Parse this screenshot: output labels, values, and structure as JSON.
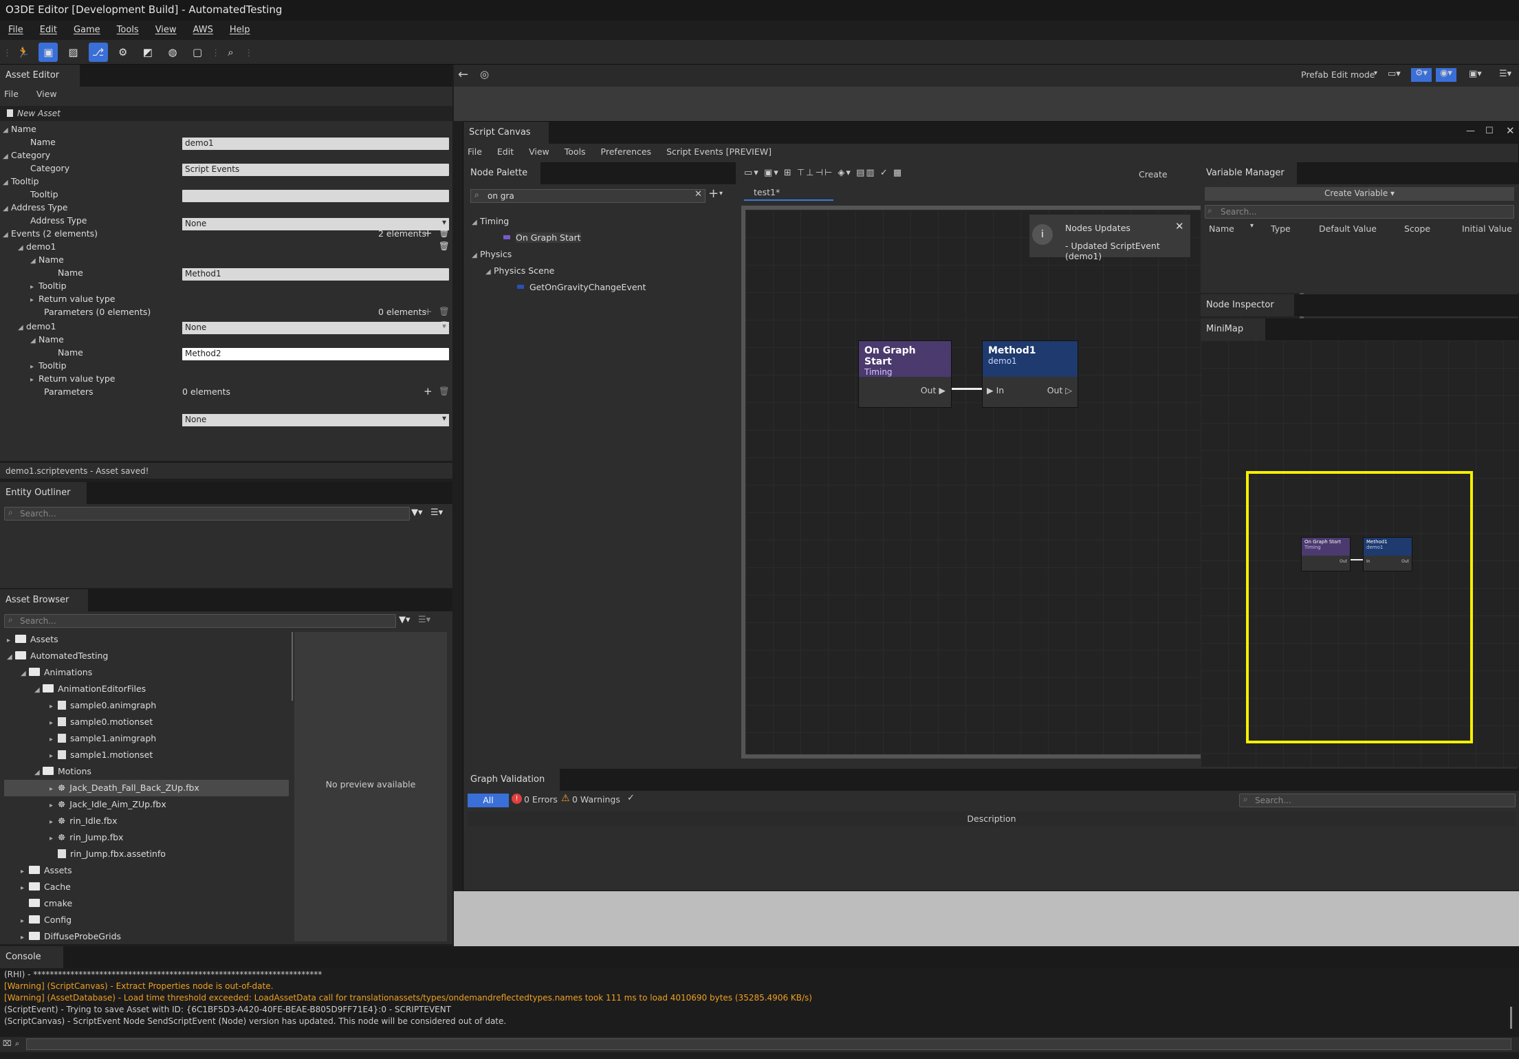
{
  "window": {
    "title": "O3DE Editor [Development Build] - AutomatedTesting"
  },
  "menu": [
    "File",
    "Edit",
    "Game",
    "Tools",
    "View",
    "AWS",
    "Help"
  ],
  "toolbar": {
    "icons": [
      "run-icon",
      "blueprint-icon",
      "image-icon",
      "script-icon",
      "gear-path-icon",
      "landscape-icon",
      "globe-icon",
      "screen-icon",
      "search-icon"
    ]
  },
  "asset_editor": {
    "tab": "Asset Editor",
    "menu": [
      "File",
      "View"
    ],
    "new_asset": "New Asset",
    "rows": {
      "name_group": "Name",
      "name_label": "Name",
      "name_value": "demo1",
      "category_group": "Category",
      "category_label": "Category",
      "category_value": "Script Events",
      "tooltip_group": "Tooltip",
      "tooltip_label": "Tooltip",
      "tooltip_value": "",
      "address_type_label": "Address Type",
      "address_type_value": "None",
      "address_type_sub": "Address Type",
      "events_label": "Events (2 elements)",
      "events_count": "2 elements",
      "ev1": "demo1",
      "ev1_name_group": "Name",
      "ev1_name_label": "Name",
      "ev1_name_value": "Method1",
      "ev1_tooltip": "Tooltip",
      "ev1_return_label": "Return value type",
      "ev1_return_value": "None",
      "ev1_params": "Parameters (0 elements)",
      "ev1_params_count": "0 elements",
      "ev2": "demo1",
      "ev2_name_group": "Name",
      "ev2_name_label": "Name",
      "ev2_name_value": "Method2",
      "ev2_tooltip": "Tooltip",
      "ev2_return_label": "Return value type",
      "ev2_return_value": "None",
      "ev2_params": "Parameters",
      "ev2_params_count": "0 elements"
    },
    "status": "demo1.scriptevents - Asset saved!"
  },
  "entity_outliner": {
    "tab": "Entity Outliner",
    "search_placeholder": "Search..."
  },
  "asset_browser": {
    "tab": "Asset Browser",
    "search_placeholder": "Search...",
    "preview": "No preview available",
    "tree": [
      {
        "label": "Assets",
        "type": "folder"
      },
      {
        "label": "AutomatedTesting",
        "type": "folder"
      },
      {
        "label": "Animations",
        "type": "folder"
      },
      {
        "label": "AnimationEditorFiles",
        "type": "folder"
      },
      {
        "label": "sample0.animgraph",
        "type": "file"
      },
      {
        "label": "sample0.motionset",
        "type": "file"
      },
      {
        "label": "sample1.animgraph",
        "type": "file"
      },
      {
        "label": "sample1.motionset",
        "type": "file"
      },
      {
        "label": "Motions",
        "type": "folder"
      },
      {
        "label": "Jack_Death_Fall_Back_ZUp.fbx",
        "type": "fbx"
      },
      {
        "label": "Jack_Idle_Aim_ZUp.fbx",
        "type": "fbx"
      },
      {
        "label": "rin_Idle.fbx",
        "type": "fbx"
      },
      {
        "label": "rin_Jump.fbx",
        "type": "fbx"
      },
      {
        "label": "rin_Jump.fbx.assetinfo",
        "type": "file"
      },
      {
        "label": "Assets",
        "type": "folder"
      },
      {
        "label": "Cache",
        "type": "folder"
      },
      {
        "label": "cmake",
        "type": "folder"
      },
      {
        "label": "Config",
        "type": "folder"
      },
      {
        "label": "DiffuseProbeGrids",
        "type": "folder"
      }
    ]
  },
  "viewport_bar": {
    "mode": "Prefab Edit mode"
  },
  "script_canvas": {
    "tab": "Script Canvas",
    "menu": [
      "File",
      "Edit",
      "View",
      "Tools",
      "Preferences",
      "Script Events [PREVIEW]"
    ],
    "node_palette": {
      "tab": "Node Palette",
      "search": "on gra",
      "tree": {
        "timing": "Timing",
        "on_graph_start": "On Graph Start",
        "physics": "Physics",
        "physics_scene": "Physics Scene",
        "gravity": "GetOnGravityChangeEvent"
      }
    },
    "graph": {
      "create": "Create",
      "tab": "test1*",
      "notification_title": "Nodes Updates",
      "notification_body": "- Updated ScriptEvent (demo1)",
      "node1": {
        "title": "On Graph Start",
        "subtitle": "Timing",
        "out": "Out",
        "color": "#4b3a6e"
      },
      "node2": {
        "title": "Method1",
        "subtitle": "demo1",
        "in": "In",
        "out": "Out",
        "color": "#1e3a6e"
      }
    },
    "variable_manager": {
      "tab": "Variable Manager",
      "create": "Create Variable ▾",
      "search_placeholder": "Search...",
      "columns": [
        "Name",
        "Type",
        "Default Value",
        "Scope",
        "Initial Value"
      ]
    },
    "node_inspector": {
      "tab": "Node Inspector"
    },
    "minimap": {
      "tab": "MiniMap",
      "node1_title": "On Graph Start",
      "node1_sub": "Timing",
      "node1_out": "Out",
      "node2_title": "Method1",
      "node2_sub": "demo1",
      "node2_in": "In",
      "node2_out": "Out"
    },
    "graph_validation": {
      "tab": "Graph Validation",
      "all": "All",
      "errors": "0 Errors",
      "warnings": "0 Warnings",
      "search_placeholder": "Search...",
      "column": "Description"
    }
  },
  "console": {
    "tab": "Console",
    "lines": [
      {
        "text": "(RHI) - **********************************************************************",
        "level": "info"
      },
      {
        "text": "[Warning] (ScriptCanvas) - Extract Properties node is out-of-date.",
        "level": "warn"
      },
      {
        "text": "[Warning] (AssetDatabase) - Load time threshold exceeded: LoadAssetData call for translationassets/types/ondemandreflectedtypes.names took 111 ms to load 4010690 bytes (35285.4906 KB/s)",
        "level": "warn"
      },
      {
        "text": "(ScriptEvent) - Trying to save Asset with ID: {6C1BF5D3-A420-40FE-BEAE-B805D9FF71E4}:0 - SCRIPTEVENT",
        "level": "info"
      },
      {
        "text": "(ScriptCanvas) - ScriptEvent Node SendScriptEvent (Node) version has updated. This node will be considered out of date.",
        "level": "info"
      }
    ]
  },
  "colors": {
    "accent": "#3a6fd8",
    "warning": "#f0a020",
    "minimap_frame": "#f5f000",
    "error": "#e04040"
  }
}
